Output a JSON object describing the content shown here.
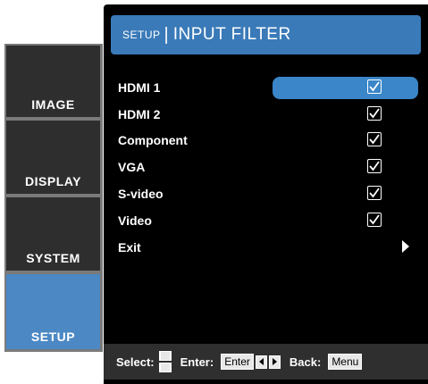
{
  "tabs": [
    {
      "label": "IMAGE",
      "active": false
    },
    {
      "label": "DISPLAY",
      "active": false
    },
    {
      "label": "SYSTEM",
      "active": false
    },
    {
      "label": "SETUP",
      "active": true
    }
  ],
  "header": {
    "crumb": "SETUP",
    "separator": "|",
    "title": "INPUT FILTER"
  },
  "items": [
    {
      "label": "HDMI 1",
      "checked": true,
      "selected": true
    },
    {
      "label": "HDMI 2",
      "checked": true
    },
    {
      "label": "Component",
      "checked": true
    },
    {
      "label": "VGA",
      "checked": true
    },
    {
      "label": "S-video",
      "checked": true
    },
    {
      "label": "Video",
      "checked": true
    },
    {
      "label": "Exit",
      "submenu_arrow": true
    }
  ],
  "footer": {
    "select_label": "Select:",
    "enter_label": "Enter:",
    "enter_key": "Enter",
    "back_label": "Back:",
    "menu_key": "Menu"
  },
  "colors": {
    "accent": "#3a7ab8",
    "highlight": "#3a86c8",
    "panel_bg": "#000000",
    "tab_bg": "#2e2e2e"
  },
  "icons": {
    "check": "checkbox-checked-icon",
    "exit_arrow": "triangle-right-icon"
  }
}
